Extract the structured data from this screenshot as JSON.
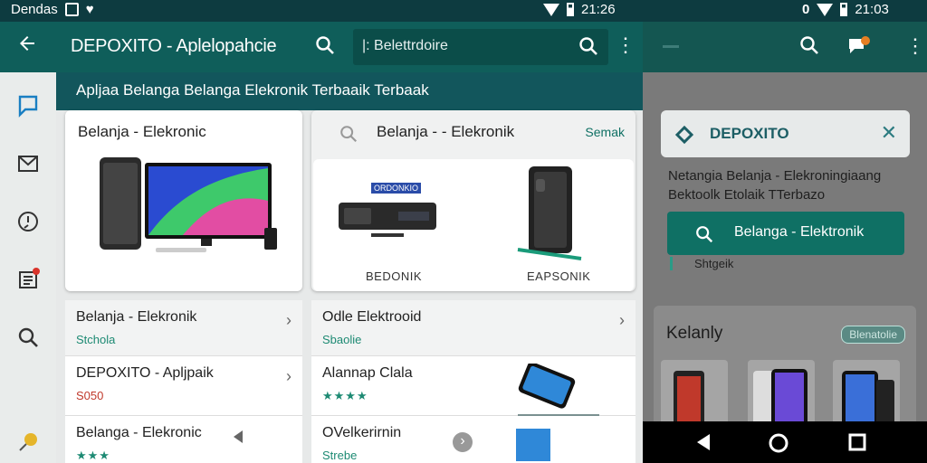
{
  "status_bar": {
    "carrier": "Dendas",
    "time_left": "21:26",
    "time_right": "21:03",
    "left_icons": [
      "gallery-icon",
      "heart-icon"
    ],
    "right_icon": "vibrate-icon"
  },
  "app_bar": {
    "title": "DEPOXITO - Aplelopahcie",
    "search_placeholder": "|: Belettrdoire"
  },
  "banner": {
    "text": "Apljaa Belanga Belanga Elekronik Terbaaik Terbaak"
  },
  "rail": {
    "items": [
      "chat-icon",
      "mail-icon",
      "alert-icon",
      "news-icon",
      "search-icon",
      "pin-icon"
    ]
  },
  "card_left": {
    "title": "Belanja - Elekronic"
  },
  "card_right": {
    "title": "Belanja - - Elekronik",
    "action": "Semak",
    "product_banner": "ORDONKIO",
    "products": [
      {
        "label": "BEDONIK"
      },
      {
        "label": "EAPSONIK"
      }
    ]
  },
  "list_left": [
    {
      "title": "Belanja - Elekronik",
      "sub": "Stchola",
      "sub_color": "#1d8a73"
    },
    {
      "title": "DEPOXITO - Apljpaik",
      "sub": "S050",
      "sub_color": "#c0392b"
    },
    {
      "title": "Belanga - Elekronic",
      "sub": "★★★",
      "sub_color": "#e3a11b"
    }
  ],
  "list_right": [
    {
      "title": "Odle Elektrooid",
      "sub": "Sbaolie",
      "sub_color": "#1d8a73"
    },
    {
      "title": "Alannap Clala",
      "sub": "★★★★",
      "sub_color": "#e3a11b"
    },
    {
      "title": "OVelkerirnin",
      "sub": "Strebe",
      "sub_color": "#1d8a73"
    }
  ],
  "right_panel": {
    "card_name": "DEPOXITO",
    "text_line1": "Netangia Belanja - Elekroningiaang",
    "text_line2": "Bektoolk Etolaik TTerbazo",
    "button_label": "Belanga - Elektronik",
    "sub": "Shtgeik",
    "section_title": "Kelanly",
    "section_badge": "Blenatolie"
  },
  "colors": {
    "primary": "#0f5e5a",
    "accent": "#0f7064",
    "status": "#0d3b40"
  }
}
